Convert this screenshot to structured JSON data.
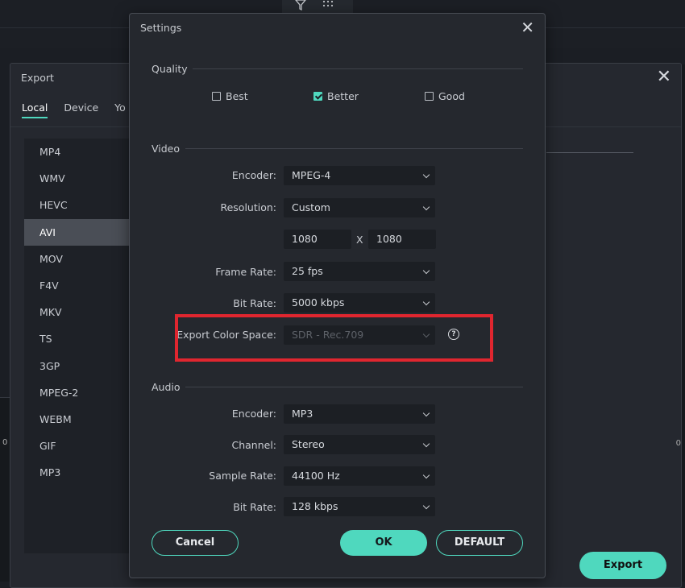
{
  "toolbar_icons": [
    "filter-icon",
    "grid-dots-icon"
  ],
  "export_window": {
    "title": "Export",
    "close_glyph": "✕",
    "tabs": [
      "Local",
      "Device",
      "Yo"
    ],
    "formats": [
      "MP4",
      "WMV",
      "HEVC",
      "AVI",
      "MOV",
      "F4V",
      "MKV",
      "TS",
      "3GP",
      "MPEG-2",
      "WEBM",
      "GIF",
      "MP3"
    ],
    "selected_format": "AVI",
    "export_label": "Export",
    "side_fragment": "0"
  },
  "settings": {
    "title": "Settings",
    "close_glyph": "✕",
    "quality": {
      "heading": "Quality",
      "options": [
        {
          "label": "Best",
          "checked": false
        },
        {
          "label": "Better",
          "checked": true
        },
        {
          "label": "Good",
          "checked": false
        }
      ]
    },
    "video": {
      "heading": "Video",
      "encoder_label": "Encoder:",
      "encoder_value": "MPEG-4",
      "resolution_label": "Resolution:",
      "resolution_value": "Custom",
      "width": "1080",
      "height": "1080",
      "x_sep": "X",
      "frame_rate_label": "Frame Rate:",
      "frame_rate_value": "25 fps",
      "bit_rate_label": "Bit Rate:",
      "bit_rate_value": "5000 kbps",
      "color_space_label": "Export Color Space:",
      "color_space_value": "SDR - Rec.709",
      "help_glyph": "?"
    },
    "audio": {
      "heading": "Audio",
      "encoder_label": "Encoder:",
      "encoder_value": "MP3",
      "channel_label": "Channel:",
      "channel_value": "Stereo",
      "sample_rate_label": "Sample Rate:",
      "sample_rate_value": "44100 Hz",
      "bit_rate_label": "Bit Rate:",
      "bit_rate_value": "128 kbps"
    },
    "buttons": {
      "cancel": "Cancel",
      "ok": "OK",
      "default": "DEFAULT"
    }
  },
  "colors": {
    "accent": "#4fd8be",
    "highlight_box": "#e0262f",
    "dialog_bg": "#25282e"
  }
}
